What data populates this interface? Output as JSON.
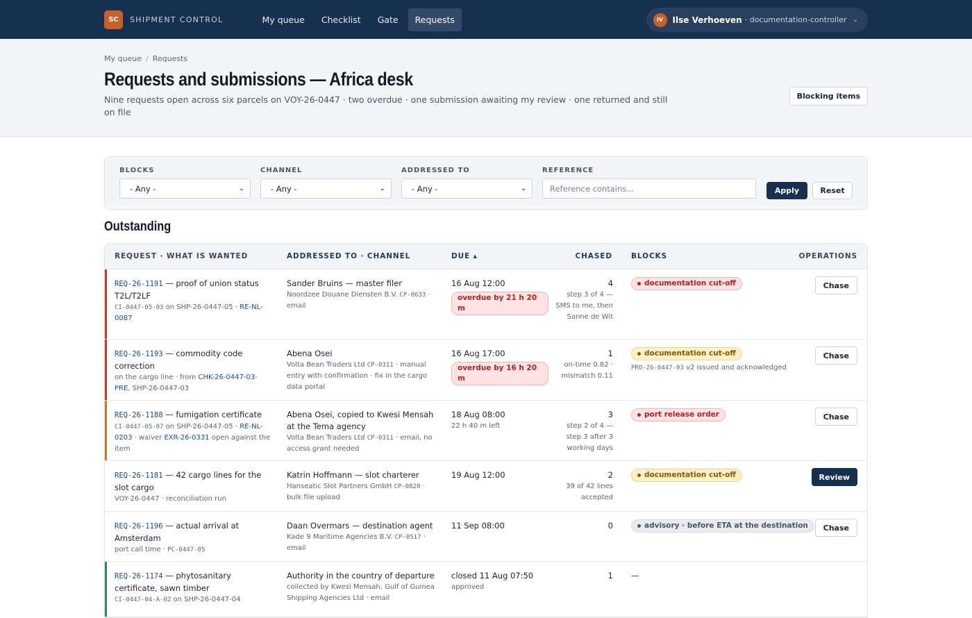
{
  "topbar": {
    "logo": "SC",
    "brand": "SHIPMENT CONTROL",
    "nav": [
      {
        "label": "My queue"
      },
      {
        "label": "Checklist"
      },
      {
        "label": "Gate"
      },
      {
        "label": "Requests",
        "active": true
      }
    ],
    "user": {
      "initials": "IV",
      "name": "Ilse Verhoeven",
      "role": "· documentation-controller",
      "chevron": "⌄"
    }
  },
  "header": {
    "breadcrumb": [
      "My queue",
      "Requests"
    ],
    "title": "Requests and submissions — Africa desk",
    "subtitle": "Nine requests open across six parcels on VOY-26-0447 · two overdue · one submission awaiting my review · one returned and still on file",
    "blocking_button": "Blocking items"
  },
  "filters": {
    "blocks": {
      "label": "BLOCKS",
      "value": "- Any -"
    },
    "channel": {
      "label": "CHANNEL",
      "value": "- Any -"
    },
    "addressed_to": {
      "label": "ADDRESSED TO",
      "value": "- Any -"
    },
    "reference": {
      "label": "REFERENCE",
      "placeholder": "Reference contains..."
    },
    "apply": "Apply",
    "reset": "Reset"
  },
  "section_title": "Outstanding",
  "table": {
    "headers": {
      "request": "REQUEST · WHAT IS WANTED",
      "addressed": "ADDRESSED TO · CHANNEL",
      "due": "DUE ▴",
      "chased": "CHASED",
      "blocks": "BLOCKS",
      "operations": "OPERATIONS"
    },
    "rows": [
      {
        "req_id": "REQ-26-1191",
        "req_what": " — proof of union status T2L/T2LF",
        "req_ref": "CI-0447-05-03",
        "req_sub1": " on SHP-26-0447-05 · ",
        "req_link": "RE-NL-0087",
        "addr_name": "Sander Bruins — master filer",
        "addr_org": "Noordzee Douane Diensten B.V. ",
        "addr_cp": "CP-0633",
        "addr_ch": " · email",
        "due": "16 Aug 12:00",
        "due_badge": "overdue by 21 h 20 m",
        "chased_n": "4",
        "chased_note": "step 3 of 4 — SMS to me, then Sanne de Wit",
        "block": "documentation cut-off",
        "block_color": "red",
        "op": "Chase",
        "accent": "#c0392b"
      },
      {
        "req_id": "REQ-26-1193",
        "req_what": " — commodity code correction",
        "req_sub_a": "on the cargo line · from ",
        "req_link": "CHK-26-0447-03-PRE",
        "req_sub_b": ", SHP-26-0447-03",
        "addr_name": "Abena Osei",
        "addr_org": "Volta Bean Traders Ltd ",
        "addr_cp": "CP-0311",
        "addr_ch": " · manual entry with confirmation · fix in the cargo data portal",
        "due": "16 Aug 17:00",
        "due_badge": "overdue by 16 h 20 m",
        "chased_n": "1",
        "chased_note": "on-time 0.82 · mismatch 0.11",
        "block": "documentation cut-off",
        "block_color": "yellow",
        "block_ref": "PRO-26-0447-03",
        "block_note": " v2 issued and acknowledged",
        "op": "Chase",
        "accent": "#c0392b"
      },
      {
        "req_id": "REQ-26-1188",
        "req_what": " — fumigation certificate",
        "req_ref": "CI-0447-05-07",
        "req_sub1": " on SHP-26-0447-05 · ",
        "req_link": "RE-NL-0203",
        "req_sub2": " · waiver ",
        "req_link2": "EXR-26-0331",
        "req_sub3": " open against the item",
        "addr_name": "Abena Osei, copied to Kwesi Mensah at the Tema agency",
        "addr_org": "Volta Bean Traders Ltd ",
        "addr_cp": "CP-0311",
        "addr_ch": " · email, no access grant needed",
        "due": "18 Aug 08:00",
        "due_note": "22 h 40 m left",
        "chased_n": "3",
        "chased_note": "step 2 of 4 — step 3 after 3 working days",
        "block": "port release order",
        "block_color": "red",
        "op": "Chase",
        "accent": "#c07a2a"
      },
      {
        "req_id": "REQ-26-1181",
        "req_what": " — 42 cargo lines for the slot cargo",
        "req_plain": "VOY-26-0447 · reconciliation run",
        "addr_name": "Katrin Hoffmann — slot charterer",
        "addr_org": "Hanseatic Slot Partners GmbH ",
        "addr_cp": "CP-0820",
        "addr_ch": " · bulk file upload",
        "due": "19 Aug 12:00",
        "chased_n": "2",
        "chased_note": "39 of 42 lines accepted",
        "block": "documentation cut-off",
        "block_color": "yellow",
        "op": "Review",
        "accent": ""
      },
      {
        "req_id": "REQ-26-1196",
        "req_what": " — actual arrival at Amsterdam",
        "req_plain": "port call time · ",
        "req_ref": "PC-0447-05",
        "addr_name": "Daan Overmars — destination agent",
        "addr_org": "Kade 9 Maritime Agencies B.V. ",
        "addr_cp": "CP-0517",
        "addr_ch": " · email",
        "due": "11 Sep 08:00",
        "chased_n": "0",
        "block": "advisory · before ETA at the destination",
        "block_color": "grey",
        "op": "Chase",
        "accent": ""
      },
      {
        "req_id": "REQ-26-1174",
        "req_what": " — phytosanitary certificate, sawn timber",
        "req_ref": "CI-0447-04-A-02",
        "req_sub1": " on SHP-26-0447-04",
        "addr_name": "Authority in the country of departure",
        "addr_note": "collected by Kwesi Mensah, Gulf of Guinea Shipping Agencies Ltd · email",
        "due": "closed 11 Aug 07:50",
        "due_note": "approved",
        "chased_n": "1",
        "block_dash": "—",
        "accent": "#2e8b57"
      }
    ]
  }
}
